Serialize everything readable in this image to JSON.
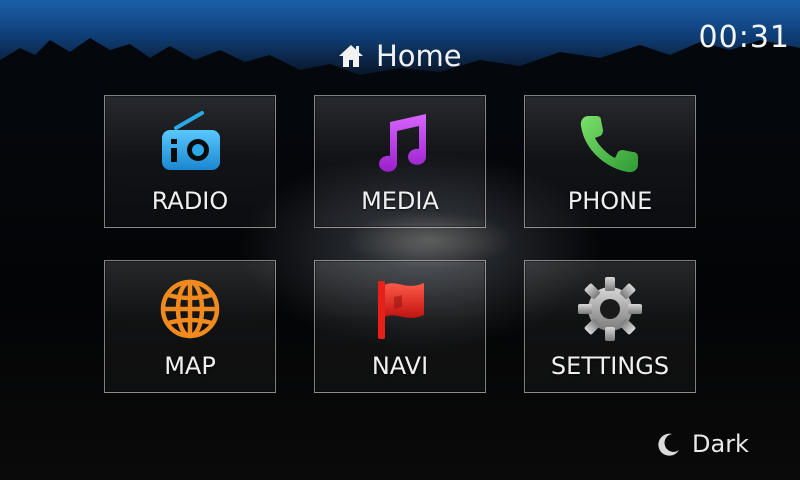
{
  "clock": {
    "time": "00:31"
  },
  "header": {
    "title": "Home",
    "icon": "home-icon"
  },
  "tiles": [
    {
      "label": "RADIO",
      "icon": "radio-icon",
      "color": "#2aa8e8"
    },
    {
      "label": "MEDIA",
      "icon": "music-note-icon",
      "color": "#b42de0"
    },
    {
      "label": "PHONE",
      "icon": "phone-icon",
      "color": "#43b84a"
    },
    {
      "label": "MAP",
      "icon": "globe-icon",
      "color": "#f08a1e"
    },
    {
      "label": "NAVI",
      "icon": "flag-icon",
      "color": "#e8201c"
    },
    {
      "label": "SETTINGS",
      "icon": "gear-icon",
      "color": "#9a9a9a"
    }
  ],
  "theme_toggle": {
    "label": "Dark",
    "icon": "moon-icon"
  }
}
